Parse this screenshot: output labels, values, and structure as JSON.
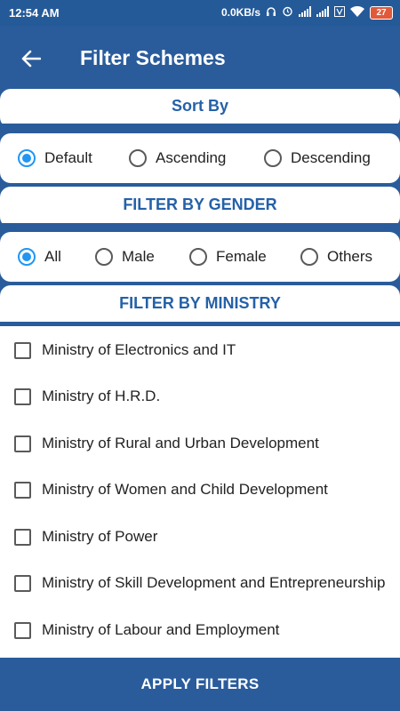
{
  "status_bar": {
    "time": "12:54 AM",
    "speed": "0.0KB/s",
    "battery": "27"
  },
  "app_bar": {
    "title": "Filter Schemes"
  },
  "sort_by": {
    "header": "Sort By",
    "options": [
      "Default",
      "Ascending",
      "Descending"
    ],
    "selected": "Default"
  },
  "gender": {
    "header": "FILTER BY GENDER",
    "options": [
      "All",
      "Male",
      "Female",
      "Others"
    ],
    "selected": "All"
  },
  "ministry": {
    "header": "FILTER BY MINISTRY",
    "items": [
      "Ministry of Electronics and IT",
      "Ministry of H.R.D.",
      "Ministry of Rural and Urban Development",
      "Ministry of Women and Child Development",
      "Ministry of Power",
      "Ministry of Skill Development and Entrepreneurship",
      "Ministry of Labour and Employment"
    ]
  },
  "apply_button": "APPLY FILTERS",
  "colors": {
    "primary": "#2a5c9c",
    "radio_selected": "#2196f3",
    "header_text": "#2461a8"
  }
}
